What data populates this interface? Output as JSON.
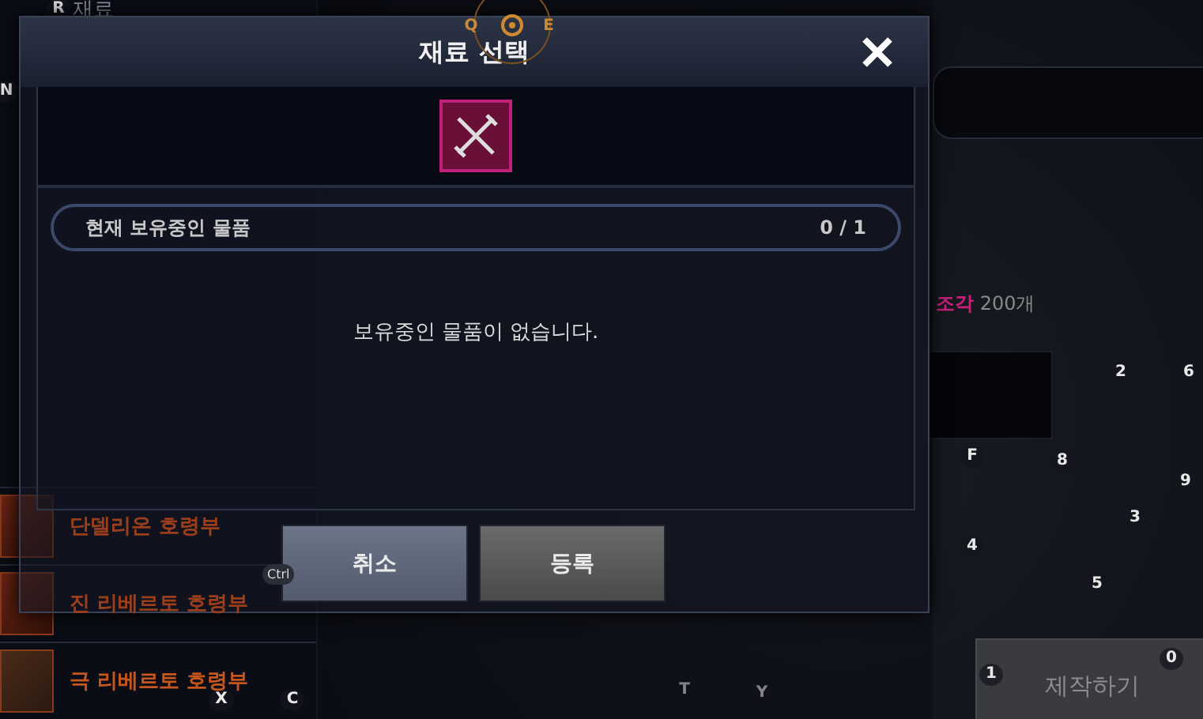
{
  "hud": {
    "menu_key": "R",
    "menu_label": "재료",
    "side_key": "N",
    "compass_keys": [
      "Q",
      "E"
    ]
  },
  "recipe_list": [
    {
      "name": "단델리온 호령부",
      "dimmed": true
    },
    {
      "name": "진 리베르토 호령부",
      "dimmed": true
    },
    {
      "name": "극 리베르토 호령부",
      "dimmed": false
    }
  ],
  "requirement_note": {
    "highlight": "조각",
    "count": "200개"
  },
  "craft_button": {
    "label": "제작하기",
    "keys": [
      "1",
      "0"
    ]
  },
  "hotkeys": [
    "2",
    "6",
    "F",
    "8",
    "9",
    "3",
    "4",
    "5",
    "X",
    "C",
    "T",
    "Y"
  ],
  "dialog": {
    "title": "재료 선택",
    "owned_label": "현재 보유중인 물품",
    "owned_count": "0 / 1",
    "empty_message": "보유중인 물품이 없습니다.",
    "buttons": [
      {
        "label": "취소",
        "kind": "cancel",
        "hotkey": "Ctrl"
      },
      {
        "label": "등록",
        "kind": "confirm"
      }
    ]
  }
}
